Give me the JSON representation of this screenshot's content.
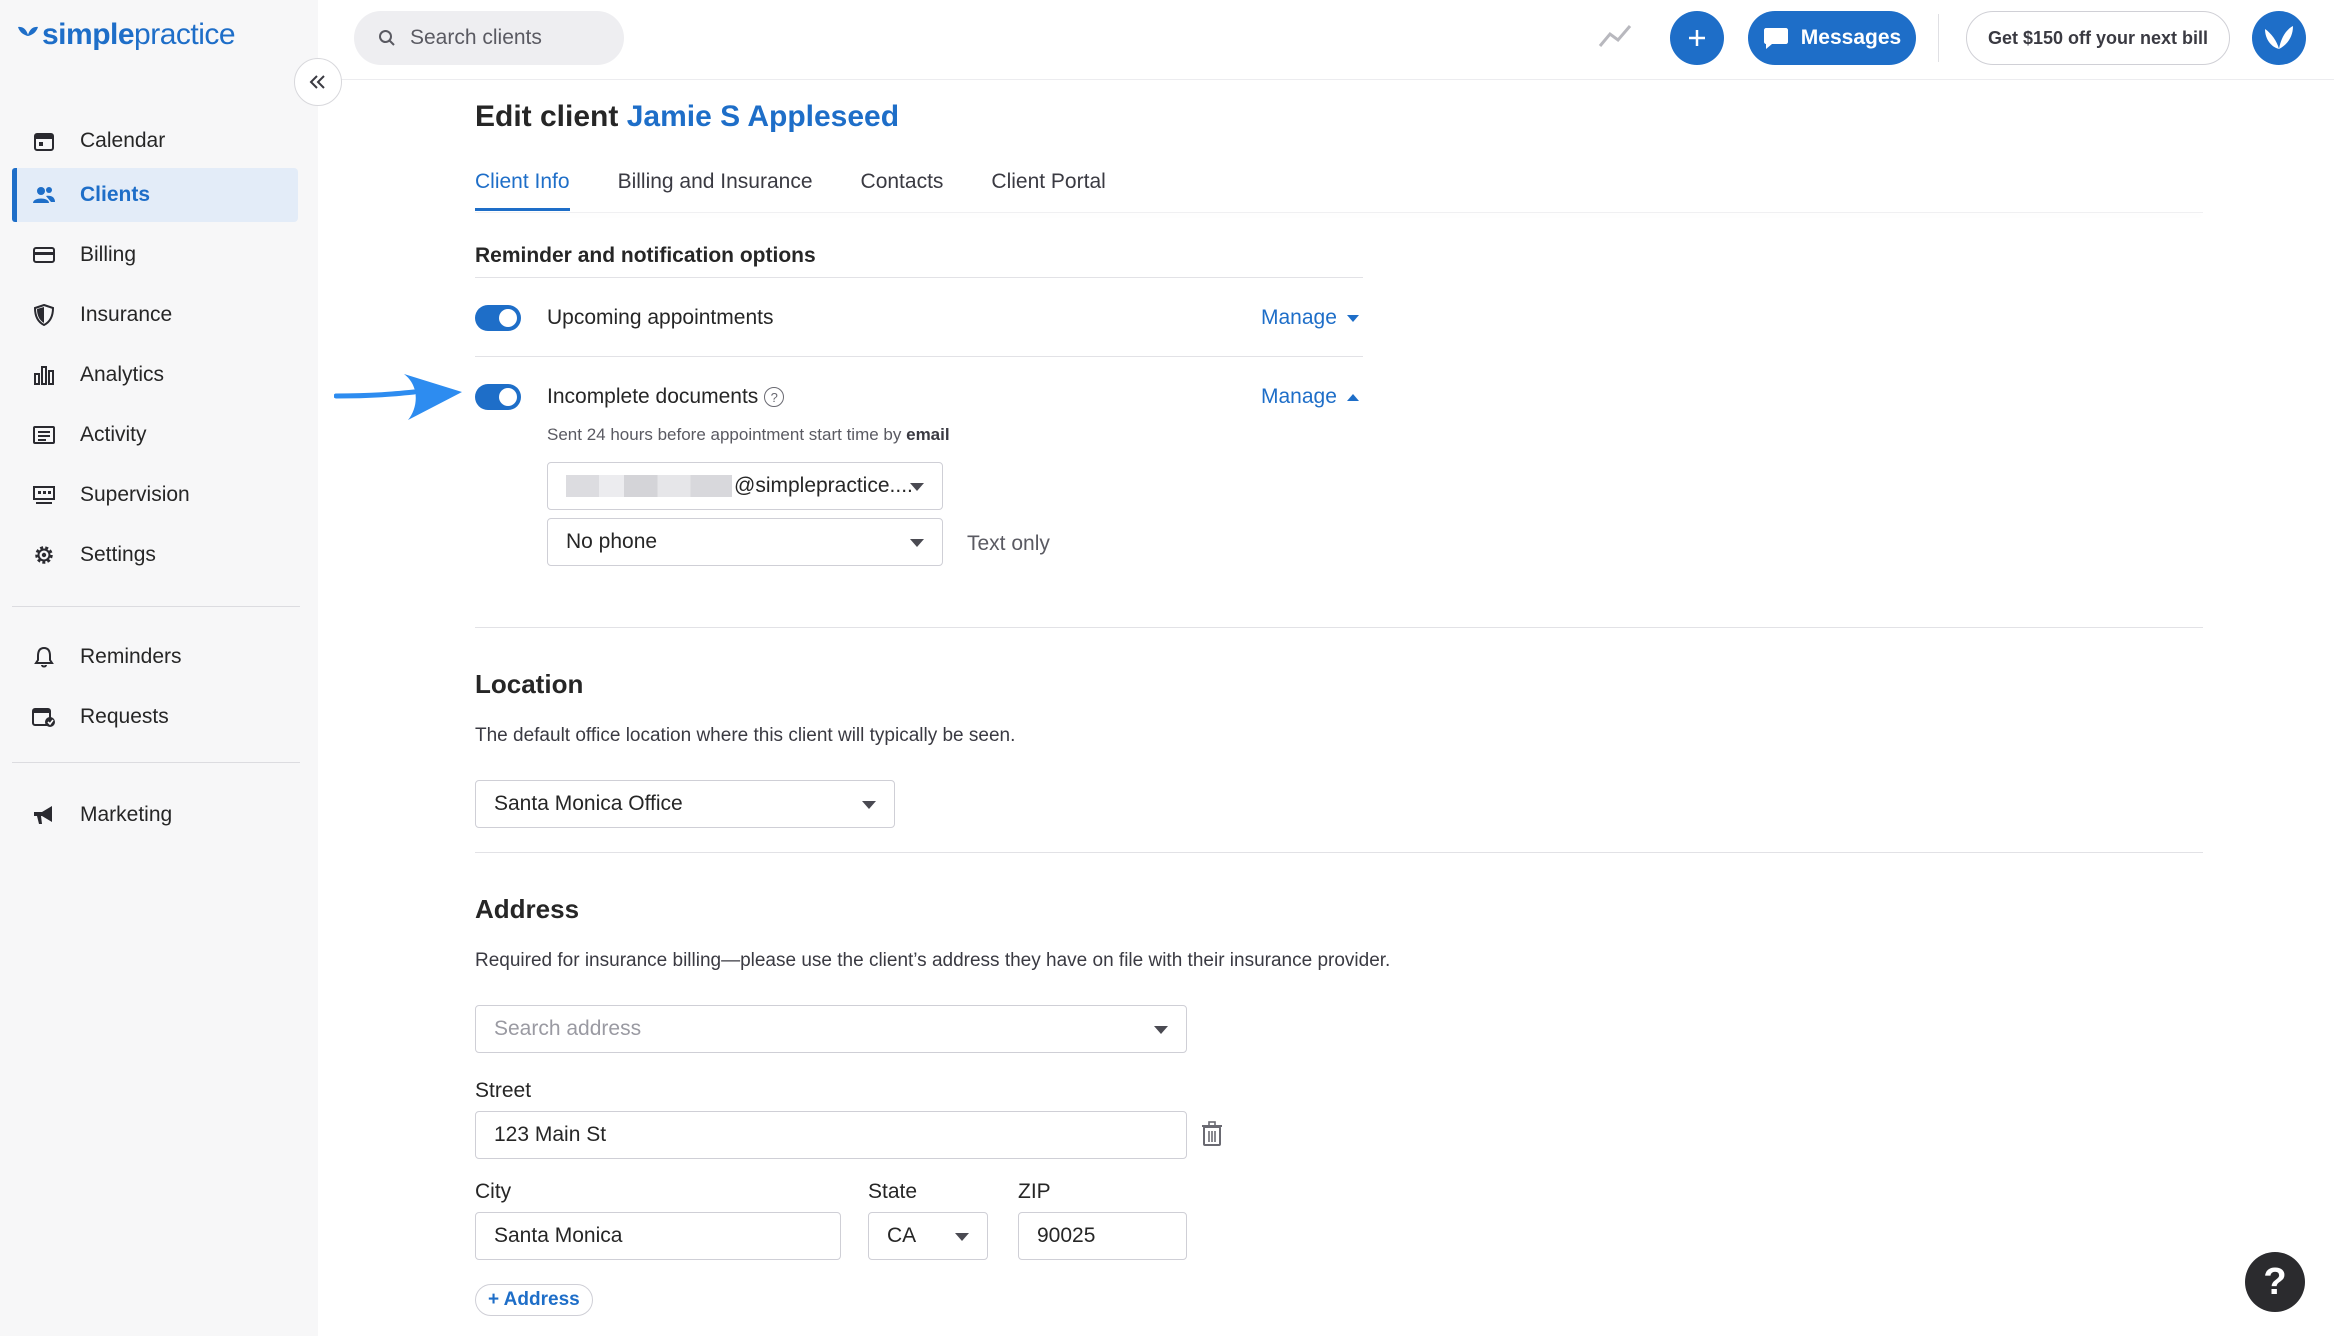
{
  "brand": {
    "logo_part1": "simple",
    "logo_part2": "practice"
  },
  "sidebar": {
    "items": [
      {
        "label": "Calendar",
        "icon": "calendar-icon"
      },
      {
        "label": "Clients",
        "icon": "clients-icon",
        "active": true
      },
      {
        "label": "Billing",
        "icon": "billing-icon"
      },
      {
        "label": "Insurance",
        "icon": "shield-icon"
      },
      {
        "label": "Analytics",
        "icon": "bar-chart-icon"
      },
      {
        "label": "Activity",
        "icon": "activity-list-icon"
      },
      {
        "label": "Supervision",
        "icon": "supervision-icon"
      },
      {
        "label": "Settings",
        "icon": "gear-icon"
      },
      {
        "label": "Reminders",
        "icon": "bell-icon"
      },
      {
        "label": "Requests",
        "icon": "requests-icon"
      },
      {
        "label": "Marketing",
        "icon": "megaphone-icon"
      }
    ]
  },
  "topbar": {
    "search_placeholder": "Search clients",
    "messages_label": "Messages",
    "promo_label": "Get $150 off your next bill"
  },
  "page": {
    "title_prefix": "Edit client",
    "client_name": "Jamie S Appleseed",
    "tabs": [
      "Client Info",
      "Billing and Insurance",
      "Contacts",
      "Client Portal"
    ],
    "active_tab": "Client Info"
  },
  "reminders": {
    "section_label": "Reminder and notification options",
    "upcoming_label": "Upcoming appointments",
    "incomplete_label": "Incomplete documents",
    "manage_label": "Manage",
    "note_prefix": "Sent 24 hours before appointment start time by",
    "note_method": "email",
    "email_value": "@simplepractice....",
    "phone_value": "No phone",
    "text_only": "Text only"
  },
  "location": {
    "heading": "Location",
    "desc": "The default office location where this client will typically be seen.",
    "value": "Santa Monica Office"
  },
  "address": {
    "heading": "Address",
    "desc": "Required for insurance billing—please use the client’s address they have on file with their insurance provider.",
    "search_placeholder": "Search address",
    "street_label": "Street",
    "street_value": "123 Main St",
    "city_label": "City",
    "city_value": "Santa Monica",
    "state_label": "State",
    "state_value": "CA",
    "zip_label": "ZIP",
    "zip_value": "90025",
    "add_label": "+ Address"
  },
  "help_label": "?",
  "colors": {
    "accent": "#1e6ec8",
    "sidebar_bg": "#f7f7f8",
    "arrow": "#2d8cf0"
  }
}
